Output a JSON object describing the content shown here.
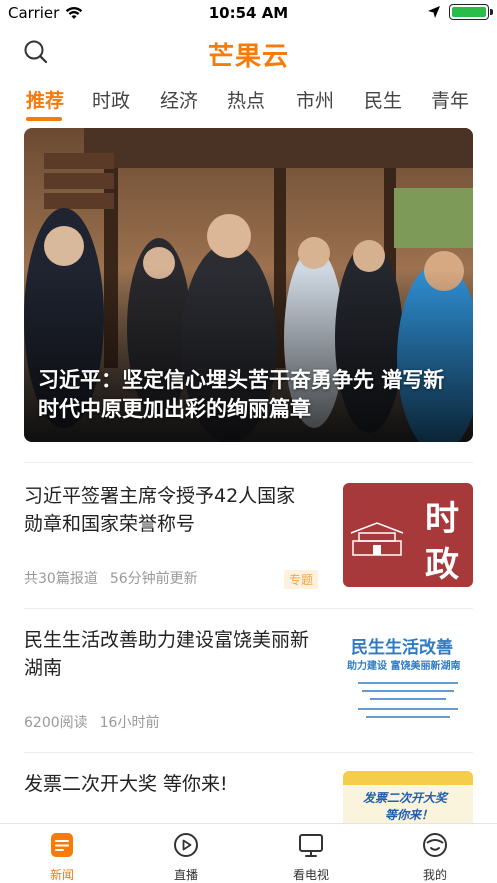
{
  "status": {
    "carrier": "Carrier",
    "time": "10:54 AM",
    "battery_level": 1.0
  },
  "nav": {
    "logo": "芒果云"
  },
  "tabs": [
    {
      "label": "推荐",
      "active": true
    },
    {
      "label": "时政",
      "active": false
    },
    {
      "label": "经济",
      "active": false
    },
    {
      "label": "热点",
      "active": false
    },
    {
      "label": "市州",
      "active": false
    },
    {
      "label": "民生",
      "active": false
    },
    {
      "label": "青年",
      "active": false
    }
  ],
  "hero": {
    "title": "习近平：坚定信心埋头苦干奋勇争先 谱写新时代中原更加出彩的绚丽篇章"
  },
  "news": [
    {
      "title": "习近平签署主席令授予42人国家勋章和国家荣誉称号",
      "meta_1": "共30篇报道",
      "meta_2": "56分钟前更新",
      "tag": "专题",
      "thumb_text_1": "时",
      "thumb_text_2": "政"
    },
    {
      "title": "民生生活改善助力建设富饶美丽新湖南",
      "meta_1": "6200阅读",
      "meta_2": "16小时前",
      "thumb_text_1": "民生生活改善",
      "thumb_text_2": "助力建设 富饶美丽新湖南"
    },
    {
      "title": "发票二次开大奖 等你来!",
      "thumb_text_1": "发票二次开大奖",
      "thumb_text_2": "等你来！"
    }
  ],
  "tabbar": [
    {
      "label": "新闻",
      "icon": "news-icon",
      "active": true
    },
    {
      "label": "直播",
      "icon": "play-icon",
      "active": false
    },
    {
      "label": "看电视",
      "icon": "tv-icon",
      "active": false
    },
    {
      "label": "我的",
      "icon": "profile-icon",
      "active": false
    }
  ],
  "colors": {
    "accent": "#f77b0b",
    "tag_text": "#f7a443",
    "thumb_red": "#a8393b"
  }
}
